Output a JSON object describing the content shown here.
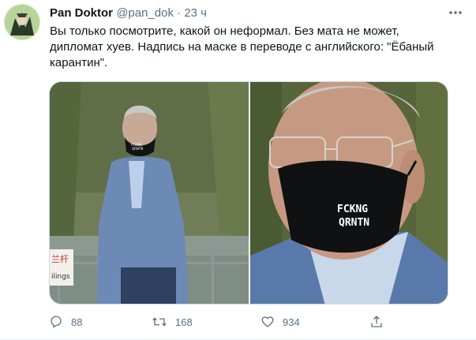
{
  "tweet": {
    "author_name": "Pan Doktor",
    "handle": "@pan_dok",
    "separator": "·",
    "time": "23 ч",
    "more_icon": "more-icon",
    "text_lines": [
      "Вы только посмотрите, какой он неформал. Без мата не может,",
      "дипломат хуев. Надпись на маске в переводе с английского: \"Ёбаный",
      "карантин\"."
    ],
    "media": {
      "left_sign_text": [
        "兰杆",
        "ilings"
      ],
      "mask_text": [
        "FCKNG",
        "QRNTN"
      ]
    },
    "actions": {
      "replies": "88",
      "retweets": "168",
      "likes": "934"
    }
  }
}
